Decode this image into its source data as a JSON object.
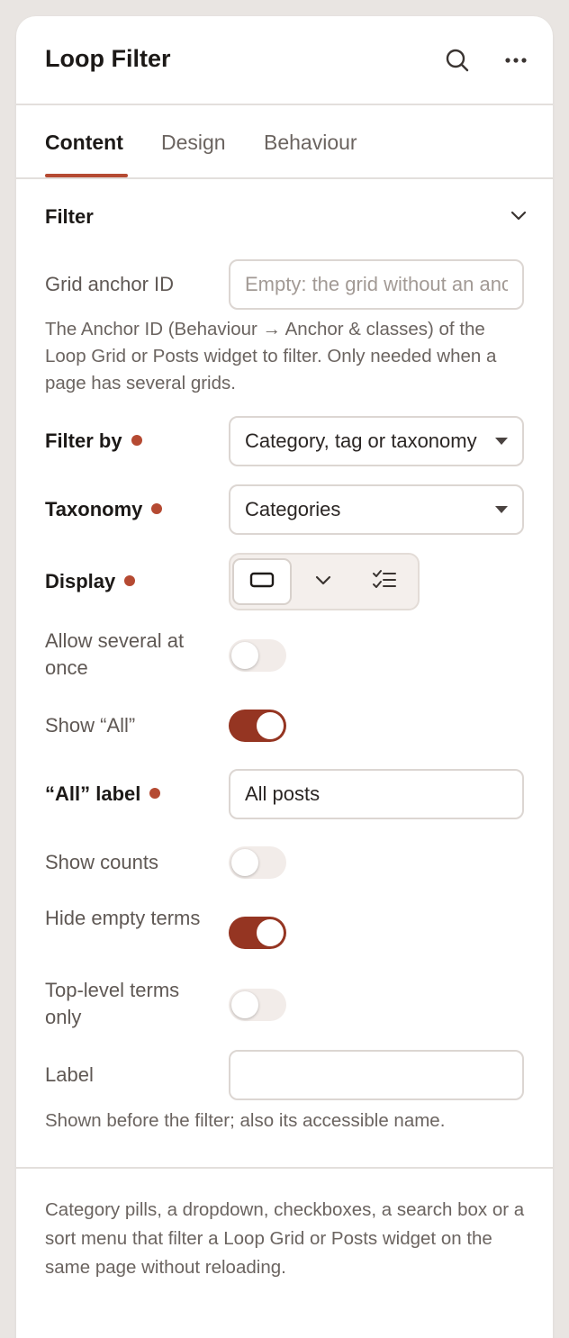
{
  "header": {
    "title": "Loop Filter",
    "search_icon": "search-icon",
    "more_icon": "more-horizontal-icon"
  },
  "tabs": [
    {
      "label": "Content",
      "active": true
    },
    {
      "label": "Design",
      "active": false
    },
    {
      "label": "Behaviour",
      "active": false
    }
  ],
  "section": {
    "title": "Filter",
    "chevron_icon": "chevron-down-icon"
  },
  "fields": {
    "grid_anchor": {
      "label": "Grid anchor ID",
      "value": "",
      "placeholder": "Empty: the grid without an anchor",
      "help": "The Anchor ID (Behaviour → Anchor & classes) of the Loop Grid or Posts widget to filter. Only needed when a page has several grids."
    },
    "filter_by": {
      "label": "Filter by",
      "value": "Category, tag or taxonomy"
    },
    "taxonomy": {
      "label": "Taxonomy",
      "value": "Categories"
    },
    "display": {
      "label": "Display",
      "options": [
        "pills-icon",
        "dropdown-icon",
        "checklist-icon"
      ],
      "selected": 0
    },
    "allow_several": {
      "label": "Allow several at once",
      "on": false
    },
    "show_all": {
      "label": "Show “All”",
      "on": true
    },
    "all_label": {
      "label": "“All” label",
      "value": "All posts"
    },
    "show_counts": {
      "label": "Show counts",
      "on": false
    },
    "hide_empty": {
      "label": "Hide empty terms",
      "on": true
    },
    "top_level": {
      "label": "Top-level terms only",
      "on": false
    },
    "label": {
      "label": "Label",
      "value": "",
      "help": "Shown before the filter; also its accessible name."
    }
  },
  "footer": {
    "description": "Category pills, a dropdown, checkboxes, a search box or a sort menu that filter a Loop Grid or Posts widget on the same page without reloading."
  },
  "colors": {
    "accent": "#b54a32",
    "toggle_on": "#953522",
    "toggle_off": "#f2ece9"
  }
}
